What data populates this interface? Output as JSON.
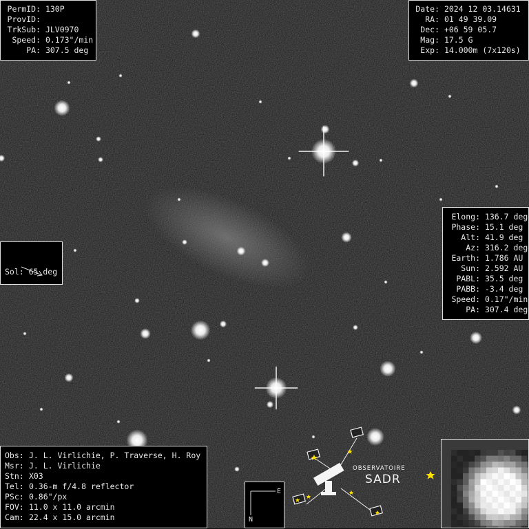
{
  "header_left": [
    {
      "label": "PermID:",
      "value": "130P"
    },
    {
      "label": "ProvID:",
      "value": ""
    },
    {
      "label": "TrkSub:",
      "value": "JLV0970"
    },
    {
      "label": "Speed:",
      "value": "0.173\"/min"
    },
    {
      "label": "PA:",
      "value": "307.5 deg"
    }
  ],
  "header_right": [
    {
      "label": "Date:",
      "value": "2024 12 03.14631"
    },
    {
      "label": "RA:",
      "value": "01 49 39.09"
    },
    {
      "label": "Dec:",
      "value": "+06 59 05.7"
    },
    {
      "label": "Mag:",
      "value": "17.5 G"
    },
    {
      "label": "Exp:",
      "value": "14.000m (7x120s)"
    }
  ],
  "ephemeris": [
    {
      "label": "Elong:",
      "value": "136.7 deg"
    },
    {
      "label": "Phase:",
      "value": "15.1 deg"
    },
    {
      "label": "Alt:",
      "value": "41.9 deg"
    },
    {
      "label": "Az:",
      "value": "316.2 deg"
    },
    {
      "label": "Earth:",
      "value": "1.786 AU"
    },
    {
      "label": "Sun:",
      "value": "2.592 AU"
    },
    {
      "label": "PABL:",
      "value": "35.5 deg"
    },
    {
      "label": "PABB:",
      "value": "-3.4 deg"
    },
    {
      "label": "Speed:",
      "value": "0.17\"/min"
    },
    {
      "label": "PA:",
      "value": "307.4 deg"
    }
  ],
  "sol": {
    "text": "Sol: 65 deg"
  },
  "observers": [
    {
      "label": "Obs:",
      "value": "J. L. Virlichie, P. Traverse, H. Roy"
    },
    {
      "label": "Msr:",
      "value": "J. L. Virlichie"
    },
    {
      "label": "Stn:",
      "value": "X03"
    },
    {
      "label": "Tel:",
      "value": "0.36-m f/4.8 reflector"
    },
    {
      "label": "PSc:",
      "value": "0.86\"/px"
    },
    {
      "label": "FOV:",
      "value": "11.0 x 11.0 arcmin"
    },
    {
      "label": "Cam:",
      "value": "22.4 x 15.0 arcmin"
    }
  ],
  "compass": {
    "east": "E",
    "north": "N"
  },
  "logo": {
    "line1": "OBSERVATOIRE",
    "line2": "SADR"
  },
  "colors": {
    "box_bg": "#000000",
    "box_border": "#dddddd",
    "text": "#e8e8e8",
    "logo_star": "#ffe100",
    "sky": "#111111"
  }
}
